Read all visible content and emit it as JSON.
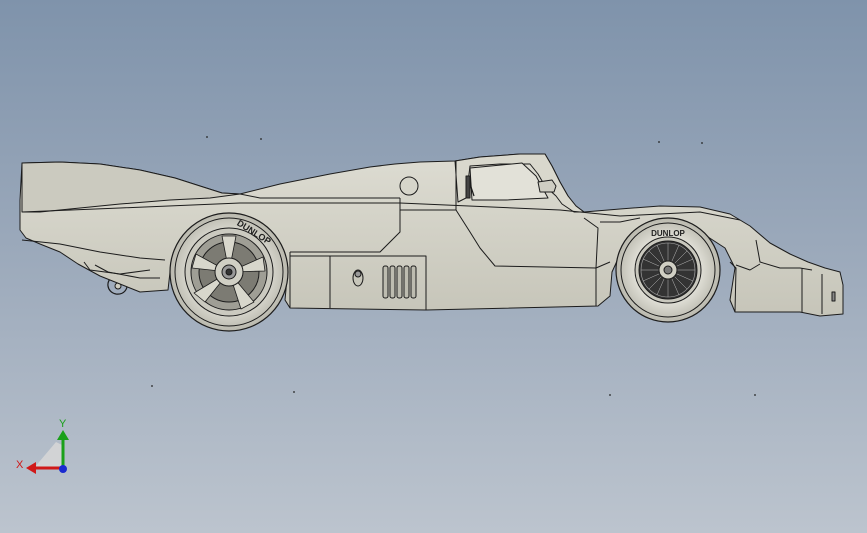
{
  "viewport": {
    "background_top": "#7f93ab",
    "background_bottom": "#bcc4ce",
    "model_fill": "#d4d3c8",
    "model_shadow": "#b7b6aa",
    "edge_color": "#1c1c1c"
  },
  "model": {
    "name_icon": "race-car-side-view",
    "tire_brand": "DUNLOP"
  },
  "triad": {
    "x_label": "X",
    "y_label": "Y",
    "x_color": "#d01818",
    "y_color": "#1aa01a",
    "z_color": "#1a2ad0"
  }
}
